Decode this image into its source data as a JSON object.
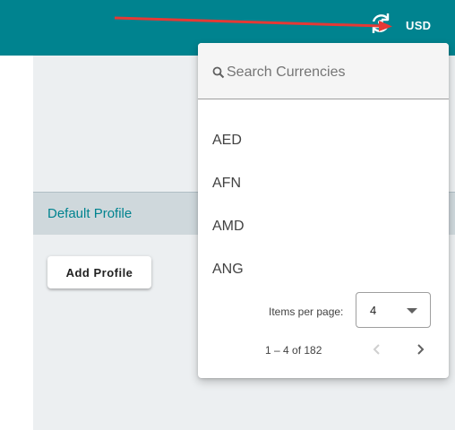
{
  "header": {
    "currency_icon": "currency-exchange-icon",
    "currency_code": "USD",
    "background_color": "#00838f"
  },
  "profile": {
    "default_label": "Default Profile",
    "add_button_label": "Add Profile"
  },
  "currency_menu": {
    "search_placeholder": "Search Currencies",
    "search_value": "",
    "items": [
      {
        "code": "AED"
      },
      {
        "code": "AFN"
      },
      {
        "code": "AMD"
      },
      {
        "code": "ANG"
      }
    ],
    "paginator": {
      "items_per_page_label": "Items per page:",
      "items_per_page_value": "4",
      "range_label": "1 – 4 of 182",
      "prev_icon": "chevron-left-icon",
      "next_icon": "chevron-right-icon"
    }
  },
  "colors": {
    "accent": "#00838f",
    "annotation_arrow": "#e53935"
  }
}
